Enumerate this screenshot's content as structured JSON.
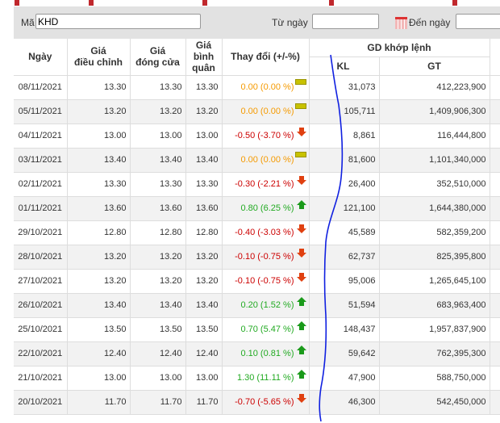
{
  "filter": {
    "ma_label": "Mã",
    "ma_value": "KHD",
    "from_label": "Từ ngày",
    "from_value": "",
    "to_label": "Đến ngày",
    "to_value": ""
  },
  "headers": {
    "date": "Ngày",
    "adj": "Giá\nđiều chỉnh",
    "close": "Giá\nđóng cửa",
    "avg": "Giá\nbình\nquân",
    "change": "Thay đổi (+/-%)",
    "matched": "GD khớp lệnh",
    "kl": "KL",
    "gt": "GT"
  },
  "rows": [
    {
      "date": "08/11/2021",
      "adj": "13.30",
      "close": "13.30",
      "avg": "13.30",
      "change": "0.00 (0.00 %)",
      "dir": "eq",
      "kl": "31,073",
      "gt": "412,223,900"
    },
    {
      "date": "05/11/2021",
      "adj": "13.20",
      "close": "13.20",
      "avg": "13.20",
      "change": "0.00 (0.00 %)",
      "dir": "eq",
      "kl": "105,711",
      "gt": "1,409,906,300"
    },
    {
      "date": "04/11/2021",
      "adj": "13.00",
      "close": "13.00",
      "avg": "13.00",
      "change": "-0.50 (-3.70 %)",
      "dir": "dn",
      "kl": "8,861",
      "gt": "116,444,800"
    },
    {
      "date": "03/11/2021",
      "adj": "13.40",
      "close": "13.40",
      "avg": "13.40",
      "change": "0.00 (0.00 %)",
      "dir": "eq",
      "kl": "81,600",
      "gt": "1,101,340,000"
    },
    {
      "date": "02/11/2021",
      "adj": "13.30",
      "close": "13.30",
      "avg": "13.30",
      "change": "-0.30 (-2.21 %)",
      "dir": "dn",
      "kl": "26,400",
      "gt": "352,510,000"
    },
    {
      "date": "01/11/2021",
      "adj": "13.60",
      "close": "13.60",
      "avg": "13.60",
      "change": "0.80 (6.25 %)",
      "dir": "up",
      "kl": "121,100",
      "gt": "1,644,380,000"
    },
    {
      "date": "29/10/2021",
      "adj": "12.80",
      "close": "12.80",
      "avg": "12.80",
      "change": "-0.40 (-3.03 %)",
      "dir": "dn",
      "kl": "45,589",
      "gt": "582,359,200"
    },
    {
      "date": "28/10/2021",
      "adj": "13.20",
      "close": "13.20",
      "avg": "13.20",
      "change": "-0.10 (-0.75 %)",
      "dir": "dn",
      "kl": "62,737",
      "gt": "825,395,800"
    },
    {
      "date": "27/10/2021",
      "adj": "13.20",
      "close": "13.20",
      "avg": "13.20",
      "change": "-0.10 (-0.75 %)",
      "dir": "dn",
      "kl": "95,006",
      "gt": "1,265,645,100"
    },
    {
      "date": "26/10/2021",
      "adj": "13.40",
      "close": "13.40",
      "avg": "13.40",
      "change": "0.20 (1.52 %)",
      "dir": "up",
      "kl": "51,594",
      "gt": "683,963,400"
    },
    {
      "date": "25/10/2021",
      "adj": "13.50",
      "close": "13.50",
      "avg": "13.50",
      "change": "0.70 (5.47 %)",
      "dir": "up",
      "kl": "148,437",
      "gt": "1,957,837,900"
    },
    {
      "date": "22/10/2021",
      "adj": "12.40",
      "close": "12.40",
      "avg": "12.40",
      "change": "0.10 (0.81 %)",
      "dir": "up",
      "kl": "59,642",
      "gt": "762,395,300"
    },
    {
      "date": "21/10/2021",
      "adj": "13.00",
      "close": "13.00",
      "avg": "13.00",
      "change": "1.30 (11.11 %)",
      "dir": "up",
      "kl": "47,900",
      "gt": "588,750,000"
    },
    {
      "date": "20/10/2021",
      "adj": "11.70",
      "close": "11.70",
      "avg": "11.70",
      "change": "-0.70 (-5.65 %)",
      "dir": "dn",
      "kl": "46,300",
      "gt": "542,450,000"
    }
  ]
}
